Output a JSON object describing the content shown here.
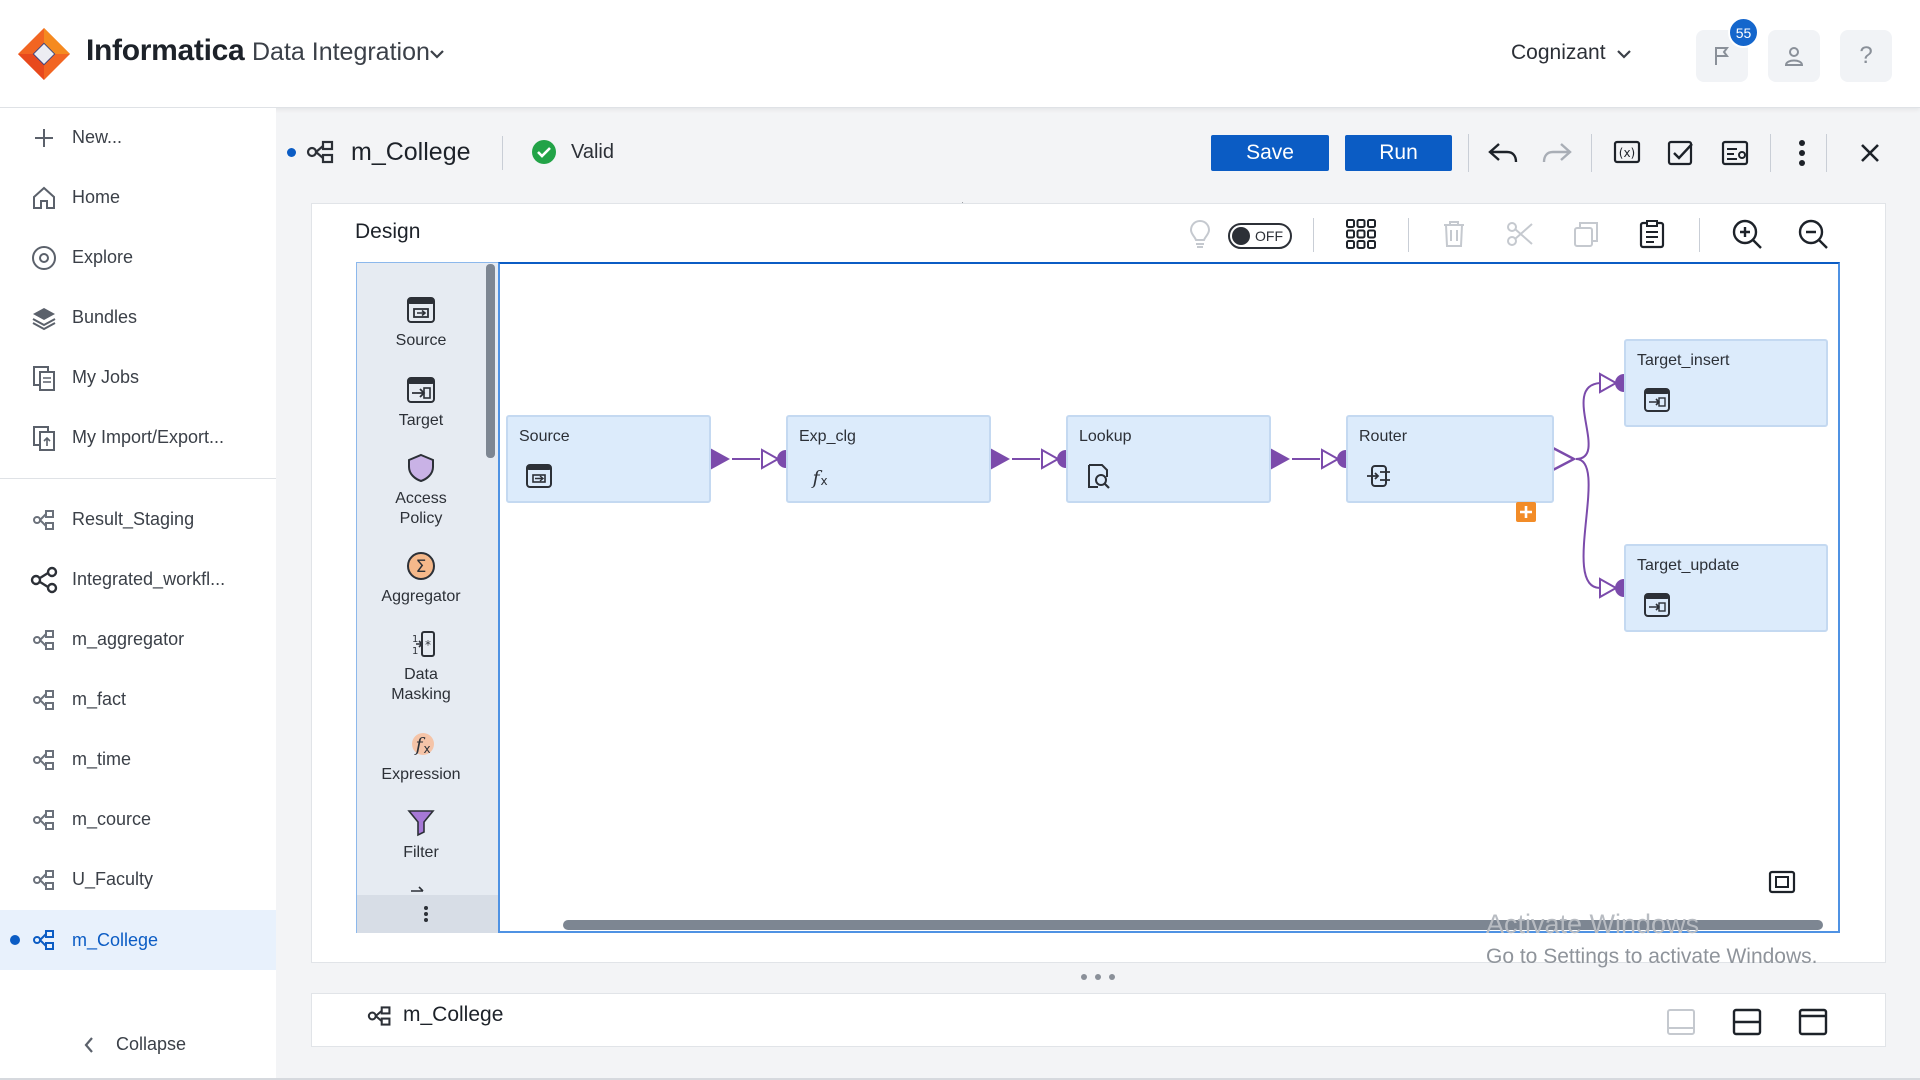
{
  "header": {
    "brand": "Informatica",
    "product": "Data Integration",
    "org": "Cognizant",
    "notification_count": "55",
    "help_label": "?"
  },
  "sidebar": {
    "new_label": "New...",
    "nav": [
      {
        "label": "Home",
        "icon": "home-icon"
      },
      {
        "label": "Explore",
        "icon": "compass-icon"
      },
      {
        "label": "Bundles",
        "icon": "layers-icon"
      },
      {
        "label": "My Jobs",
        "icon": "jobs-icon"
      },
      {
        "label": "My Import/Export...",
        "icon": "import-export-icon"
      }
    ],
    "assets": [
      {
        "label": "Result_Staging",
        "icon": "mapping-icon"
      },
      {
        "label": "Integrated_workfl...",
        "icon": "workflow-icon"
      },
      {
        "label": "m_aggregator",
        "icon": "mapping-icon"
      },
      {
        "label": "m_fact",
        "icon": "mapping-icon"
      },
      {
        "label": "m_time",
        "icon": "mapping-icon"
      },
      {
        "label": "m_cource",
        "icon": "mapping-icon"
      },
      {
        "label": "U_Faculty",
        "icon": "mapping-icon"
      },
      {
        "label": "m_College",
        "icon": "mapping-icon",
        "active": true
      }
    ],
    "collapse_label": "Collapse"
  },
  "toolbar": {
    "mapping_name": "m_College",
    "status": "Valid",
    "save_label": "Save",
    "run_label": "Run"
  },
  "design": {
    "title": "Design",
    "toggle_label": "OFF",
    "palette": [
      {
        "label_lines": [
          "Source"
        ],
        "icon": "source-icon"
      },
      {
        "label_lines": [
          "Target"
        ],
        "icon": "target-icon"
      },
      {
        "label_lines": [
          "Access",
          "Policy"
        ],
        "icon": "shield-icon"
      },
      {
        "label_lines": [
          "Aggregator"
        ],
        "icon": "sigma-icon"
      },
      {
        "label_lines": [
          "Data",
          "Masking"
        ],
        "icon": "data-masking-icon"
      },
      {
        "label_lines": [
          "Expression"
        ],
        "icon": "expression-icon"
      },
      {
        "label_lines": [
          "Filter"
        ],
        "icon": "filter-icon"
      }
    ],
    "nodes": [
      {
        "label": "Source",
        "icon": "source-icon"
      },
      {
        "label": "Exp_clg",
        "icon": "expression-icon"
      },
      {
        "label": "Lookup",
        "icon": "lookup-icon"
      },
      {
        "label": "Router",
        "icon": "router-icon"
      },
      {
        "label": "Target_insert",
        "icon": "target-icon"
      },
      {
        "label": "Target_update",
        "icon": "target-icon"
      }
    ]
  },
  "watermark": {
    "line1": "Activate Windows",
    "line2": "Go to Settings to activate Windows."
  },
  "bottom": {
    "title": "m_College"
  },
  "colors": {
    "primary": "#0b5cc4",
    "node_fill": "#dcebfb",
    "port": "#7b4bab",
    "valid": "#22a347",
    "router_plus": "#f28c28"
  }
}
